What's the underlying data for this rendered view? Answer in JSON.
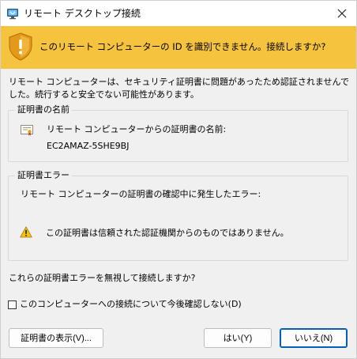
{
  "window": {
    "title": "リモート デスクトップ接続",
    "close_icon": "close-icon",
    "app_icon": "remote-desktop-icon"
  },
  "banner": {
    "text": "このリモート コンピューターの ID を識別できません。接続しますか?",
    "icon": "warning-shield-icon",
    "color": "#f6c33f"
  },
  "intro": {
    "text": "リモート コンピューターは、セキュリティ証明書に問題があったため認証されませんでした。続行すると安全でない可能性があります。"
  },
  "cert_group": {
    "label": "証明書の名前",
    "icon": "certificate-icon",
    "name_label": "リモート コンピューターからの証明書の名前:",
    "name_value": "EC2AMAZ-5SHE9BJ"
  },
  "error_group": {
    "label": "証明書エラー",
    "intro": "リモート コンピューターの証明書の確認中に発生したエラー:",
    "icon": "warning-icon",
    "detail": "この証明書は信頼された認証機関からのものではありません。"
  },
  "question": {
    "text": "これらの証明書エラーを無視して接続しますか?"
  },
  "checkbox": {
    "label": "このコンピューターへの接続について今後確認しない(D)",
    "checked": false
  },
  "buttons": {
    "view_cert": "証明書の表示(V)...",
    "yes": "はい(Y)",
    "no": "いいえ(N)"
  }
}
